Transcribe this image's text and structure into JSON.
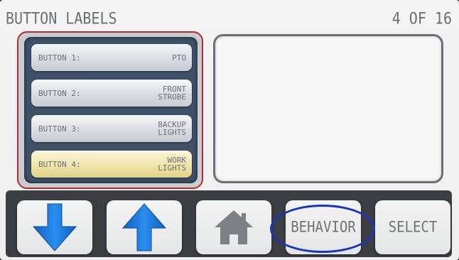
{
  "header": {
    "title": "BUTTON LABELS",
    "page_counter": "4 OF 16"
  },
  "labels": [
    {
      "name": "BUTTON 1:",
      "value_line1": "PTO",
      "value_line2": ""
    },
    {
      "name": "BUTTON 2:",
      "value_line1": "FRONT",
      "value_line2": "STROBE"
    },
    {
      "name": "BUTTON 3:",
      "value_line1": "BACKUP",
      "value_line2": "LIGHTS"
    },
    {
      "name": "BUTTON 4:",
      "value_line1": "WORK",
      "value_line2": "LIGHTS"
    }
  ],
  "selected_index": 3,
  "nav": {
    "down_icon": "arrow-down-icon",
    "up_icon": "arrow-up-icon",
    "home_icon": "home-icon",
    "behavior_label": "BEHAVIOR",
    "select_label": "SELECT"
  },
  "colors": {
    "panel_border": "#b52a2a",
    "arrow_blue": "#1e7ee0",
    "selected_highlight": "#f0e4a8",
    "annotation_circle": "#1a35b8"
  }
}
